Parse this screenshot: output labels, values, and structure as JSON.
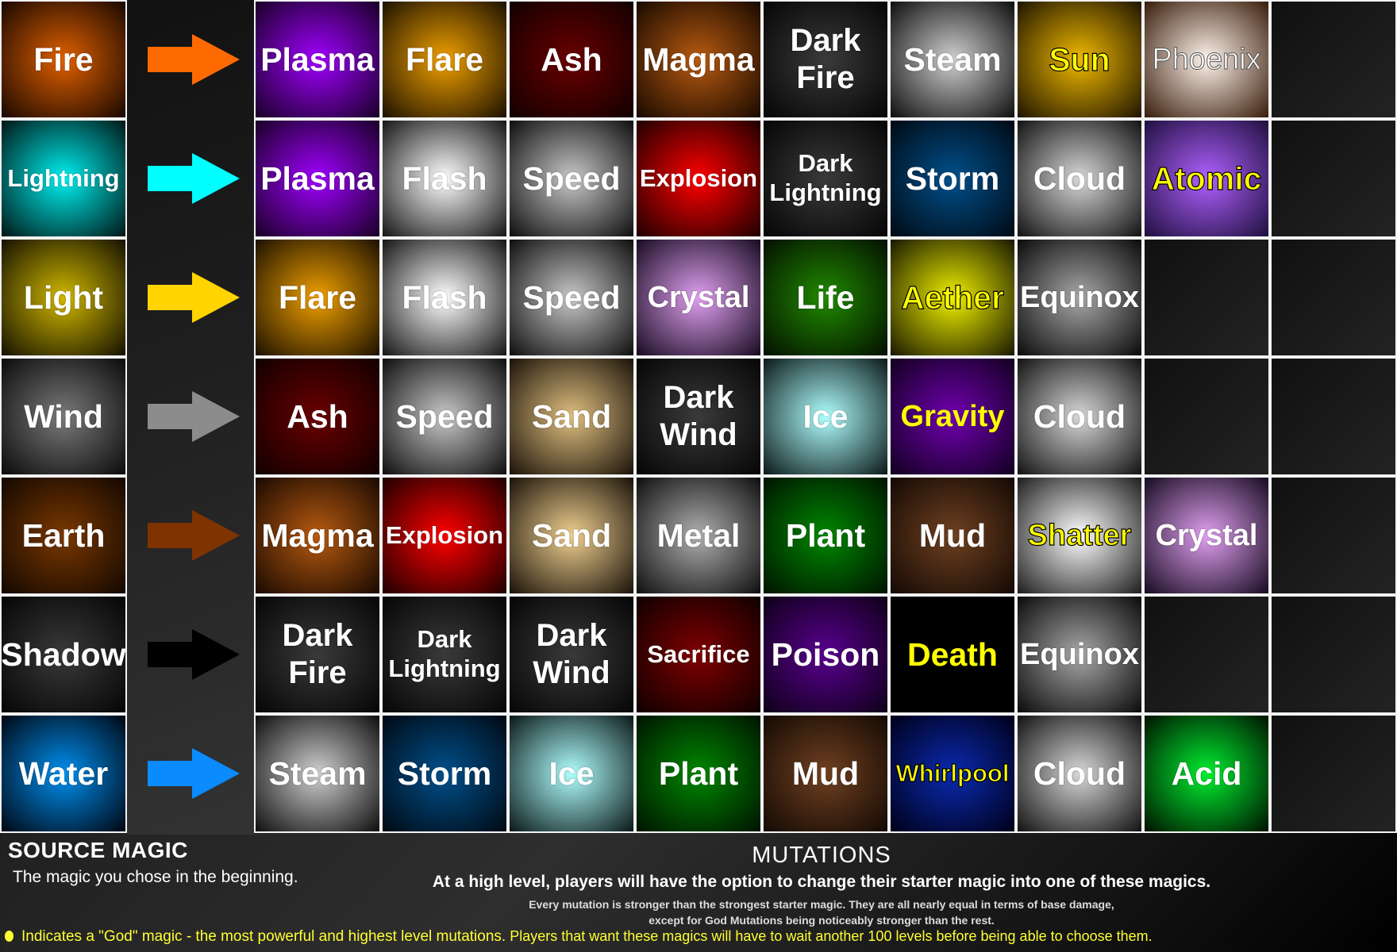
{
  "rows": [
    {
      "source": {
        "label": "Fire",
        "glow": "#e06000",
        "edge": "#1a0800"
      },
      "arrow_color": "#ff6a00",
      "mutations": [
        {
          "label": "Plasma",
          "glow": "#a000ff",
          "edge": "#1a0028",
          "god": false
        },
        {
          "label": "Flare",
          "glow": "#f0a000",
          "edge": "#1e1200",
          "god": false
        },
        {
          "label": "Ash",
          "glow": "#6a0000",
          "edge": "#120000",
          "god": false
        },
        {
          "label": "Magma",
          "glow": "#b85a10",
          "edge": "#1a0a00",
          "god": false
        },
        {
          "label": "Dark Fire",
          "glow": "#3a3a3a",
          "edge": "#060606",
          "god": false
        },
        {
          "label": "Steam",
          "glow": "#d0d0d0",
          "edge": "#101010",
          "god": false
        },
        {
          "label": "Sun",
          "glow": "#f0b800",
          "edge": "#201600",
          "god": true,
          "outline": true
        },
        {
          "label": "Phoenix",
          "glow": "#fff4ec",
          "edge": "#3a1e0c",
          "god": false,
          "style": "phoenix"
        },
        null
      ]
    },
    {
      "source": {
        "label": "Lightning",
        "glow": "#00f0f0",
        "edge": "#001818"
      },
      "arrow_color": "#00ffff",
      "mutations": [
        {
          "label": "Plasma",
          "glow": "#a000ff",
          "edge": "#1a0028",
          "god": false
        },
        {
          "label": "Flash",
          "glow": "#ffffff",
          "edge": "#181818",
          "god": false
        },
        {
          "label": "Speed",
          "glow": "#c8c8c8",
          "edge": "#101010",
          "god": false
        },
        {
          "label": "Explosion",
          "glow": "#ff0000",
          "edge": "#200000",
          "god": false
        },
        {
          "label": "Dark Lightning",
          "glow": "#3a3a3a",
          "edge": "#060606",
          "god": false
        },
        {
          "label": "Storm",
          "glow": "#00508c",
          "edge": "#000a14",
          "god": false
        },
        {
          "label": "Cloud",
          "glow": "#d8d8d8",
          "edge": "#141414",
          "god": false
        },
        {
          "label": "Atomic",
          "glow": "#b060ff",
          "edge": "#201040",
          "god": true,
          "outline": true
        },
        null
      ]
    },
    {
      "source": {
        "label": "Light",
        "glow": "#d0b800",
        "edge": "#161200"
      },
      "arrow_color": "#ffd400",
      "mutations": [
        {
          "label": "Flare",
          "glow": "#f0a000",
          "edge": "#1e1200",
          "god": false
        },
        {
          "label": "Flash",
          "glow": "#ffffff",
          "edge": "#181818",
          "god": false
        },
        {
          "label": "Speed",
          "glow": "#c8c8c8",
          "edge": "#101010",
          "god": false
        },
        {
          "label": "Crystal",
          "glow": "#e0a0f0",
          "edge": "#180c22",
          "god": false
        },
        {
          "label": "Life",
          "glow": "#208a00",
          "edge": "#041000",
          "god": false
        },
        {
          "label": "Aether",
          "glow": "#f0f000",
          "edge": "#1a1a00",
          "god": true,
          "outline": true
        },
        {
          "label": "Equinox",
          "glow": "#a8a8a8",
          "edge": "#0c0c0c",
          "god": false
        },
        null,
        null
      ]
    },
    {
      "source": {
        "label": "Wind",
        "glow": "#7a7a7a",
        "edge": "#0c0c0c"
      },
      "arrow_color": "#8c8c8c",
      "mutations": [
        {
          "label": "Ash",
          "glow": "#6a0000",
          "edge": "#120000",
          "god": false
        },
        {
          "label": "Speed",
          "glow": "#c8c8c8",
          "edge": "#101010",
          "god": false
        },
        {
          "label": "Sand",
          "glow": "#e0c080",
          "edge": "#1c140a",
          "god": false
        },
        {
          "label": "Dark Wind",
          "glow": "#3a3a3a",
          "edge": "#060606",
          "god": false
        },
        {
          "label": "Ice",
          "glow": "#b0ffff",
          "edge": "#0c1a1a",
          "god": false
        },
        {
          "label": "Gravity",
          "glow": "#7000b0",
          "edge": "#120020",
          "god": true,
          "outline": false
        },
        {
          "label": "Cloud",
          "glow": "#d8d8d8",
          "edge": "#141414",
          "god": false
        },
        null,
        null
      ]
    },
    {
      "source": {
        "label": "Earth",
        "glow": "#7a3800",
        "edge": "#140800"
      },
      "arrow_color": "#7e3300",
      "mutations": [
        {
          "label": "Magma",
          "glow": "#b85a10",
          "edge": "#1a0a00",
          "god": false
        },
        {
          "label": "Explosion",
          "glow": "#ff0000",
          "edge": "#200000",
          "god": false
        },
        {
          "label": "Sand",
          "glow": "#f0d090",
          "edge": "#1c140a",
          "god": false
        },
        {
          "label": "Metal",
          "glow": "#b0b0b0",
          "edge": "#101010",
          "god": false
        },
        {
          "label": "Plant",
          "glow": "#008800",
          "edge": "#001400",
          "god": false
        },
        {
          "label": "Mud",
          "glow": "#704020",
          "edge": "#140a04",
          "god": false
        },
        {
          "label": "Shatter",
          "glow": "#ffffff",
          "edge": "#202020",
          "god": true,
          "outline": true
        },
        {
          "label": "Crystal",
          "glow": "#e0a0f0",
          "edge": "#180c22",
          "god": false
        },
        null
      ]
    },
    {
      "source": {
        "label": "Shadow",
        "glow": "#3a3a3a",
        "edge": "#060606"
      },
      "arrow_color": "#000000",
      "mutations": [
        {
          "label": "Dark Fire",
          "glow": "#3a3a3a",
          "edge": "#060606",
          "god": false
        },
        {
          "label": "Dark Lightning",
          "glow": "#3a3a3a",
          "edge": "#060606",
          "god": false
        },
        {
          "label": "Dark Wind",
          "glow": "#3a3a3a",
          "edge": "#060606",
          "god": false
        },
        {
          "label": "Sacrifice",
          "glow": "#800000",
          "edge": "#100000",
          "god": false
        },
        {
          "label": "Poison",
          "glow": "#5a0090",
          "edge": "#0e0018",
          "god": false
        },
        {
          "label": "Death",
          "glow": "#000000",
          "edge": "#000000",
          "god": true,
          "outline": false
        },
        {
          "label": "Equinox",
          "glow": "#a8a8a8",
          "edge": "#0c0c0c",
          "god": false
        },
        null,
        null
      ]
    },
    {
      "source": {
        "label": "Water",
        "glow": "#0090f0",
        "edge": "#000814"
      },
      "arrow_color": "#0a8cff",
      "mutations": [
        {
          "label": "Steam",
          "glow": "#d0d0d0",
          "edge": "#101010",
          "god": false
        },
        {
          "label": "Storm",
          "glow": "#00508c",
          "edge": "#000a14",
          "god": false
        },
        {
          "label": "Ice",
          "glow": "#b0ffff",
          "edge": "#0c1a1a",
          "god": false
        },
        {
          "label": "Plant",
          "glow": "#008800",
          "edge": "#001400",
          "god": false
        },
        {
          "label": "Mud",
          "glow": "#704020",
          "edge": "#140a04",
          "god": false
        },
        {
          "label": "Whirlpool",
          "glow": "#0a2ab0",
          "edge": "#00001a",
          "god": true,
          "outline": true
        },
        {
          "label": "Cloud",
          "glow": "#d8d8d8",
          "edge": "#141414",
          "god": false
        },
        {
          "label": "Acid",
          "glow": "#00ee30",
          "edge": "#001400",
          "god": false
        },
        null
      ]
    }
  ],
  "footer": {
    "source_title": "SOURCE MAGIC",
    "source_desc": "The magic you chose in the beginning.",
    "mutations_title": "MUTATIONS",
    "mutations_desc": "At a high level, players will have the option to change their starter magic into one of these magics.",
    "mutations_note_1": "Every mutation is stronger than the strongest starter magic. They are all nearly equal in terms of base damage,",
    "mutations_note_2": "except for God Mutations being noticeably stronger than the rest.",
    "god_legend": "Indicates a \"God\" magic - the most powerful and highest level mutations.",
    "god_legend_tail": " Players that want these magics will have to wait another 100 levels before being able to choose them.",
    "god_color": "#ffff00"
  }
}
